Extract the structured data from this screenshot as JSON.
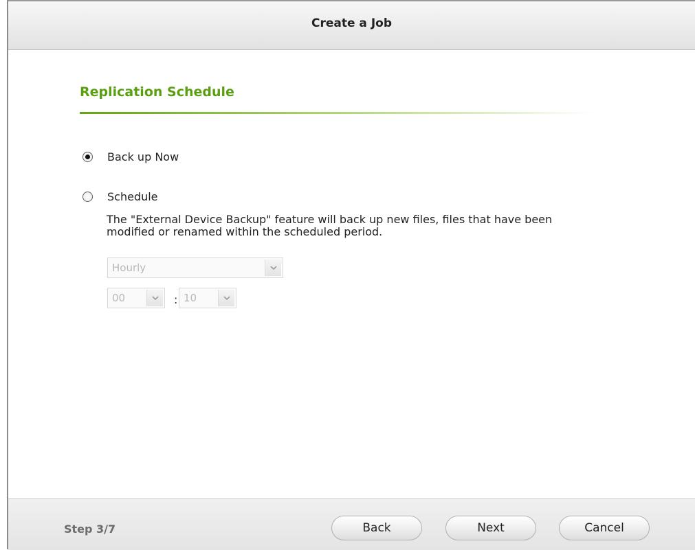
{
  "window": {
    "title": "Create a Job"
  },
  "section": {
    "title": "Replication Schedule"
  },
  "options": {
    "backup_now": {
      "label": "Back up Now",
      "selected": true
    },
    "schedule": {
      "label": "Schedule",
      "selected": false,
      "description": "The \"External Device Backup\" feature will back up new files, files that have been modified or renamed within the scheduled period."
    }
  },
  "schedule_controls": {
    "frequency": "Hourly",
    "hour": "00",
    "separator": ":",
    "minute": "10"
  },
  "footer": {
    "step": "Step 3/7",
    "back_label": "Back",
    "next_label": "Next",
    "cancel_label": "Cancel"
  },
  "colors": {
    "accent": "#5a9e12"
  }
}
